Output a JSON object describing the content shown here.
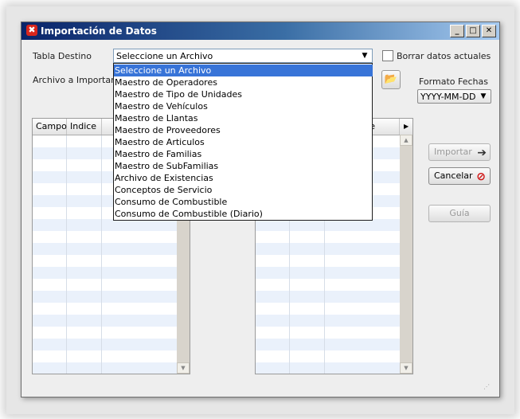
{
  "window": {
    "title": "Importación de Datos",
    "min": "_",
    "max": "□",
    "close": "✕"
  },
  "form": {
    "tabla_label": "Tabla Destino",
    "tabla_value": "Seleccione un Archivo",
    "borrar_label": "Borrar datos actuales",
    "archivo_label": "Archivo a Importar",
    "formato_label": "Formato Fechas",
    "formato_value": "YYYY-MM-DD"
  },
  "left_table": {
    "col1": "Campo",
    "col2": "Indice"
  },
  "right_table": {
    "col_partial": "e"
  },
  "buttons": {
    "importar": "Importar",
    "cancelar": "Cancelar",
    "guia": "Guía"
  },
  "dropdown": {
    "items": [
      "Seleccione un Archivo",
      "Maestro de Operadores",
      "Maestro de Tipo de Unidades",
      "Maestro de Vehículos",
      "Maestro de Llantas",
      "Maestro de Proveedores",
      "Maestro de Articulos",
      "Maestro de Familias",
      "Maestro de SubFamilias",
      "Archivo de Existencias",
      "Conceptos de Servicio",
      "Consumo de Combustible",
      "Consumo de Combustible (Diario)"
    ],
    "selected": 0
  },
  "icons": {
    "folder": "📂",
    "arrow": "➔",
    "cancel": "⃠"
  }
}
